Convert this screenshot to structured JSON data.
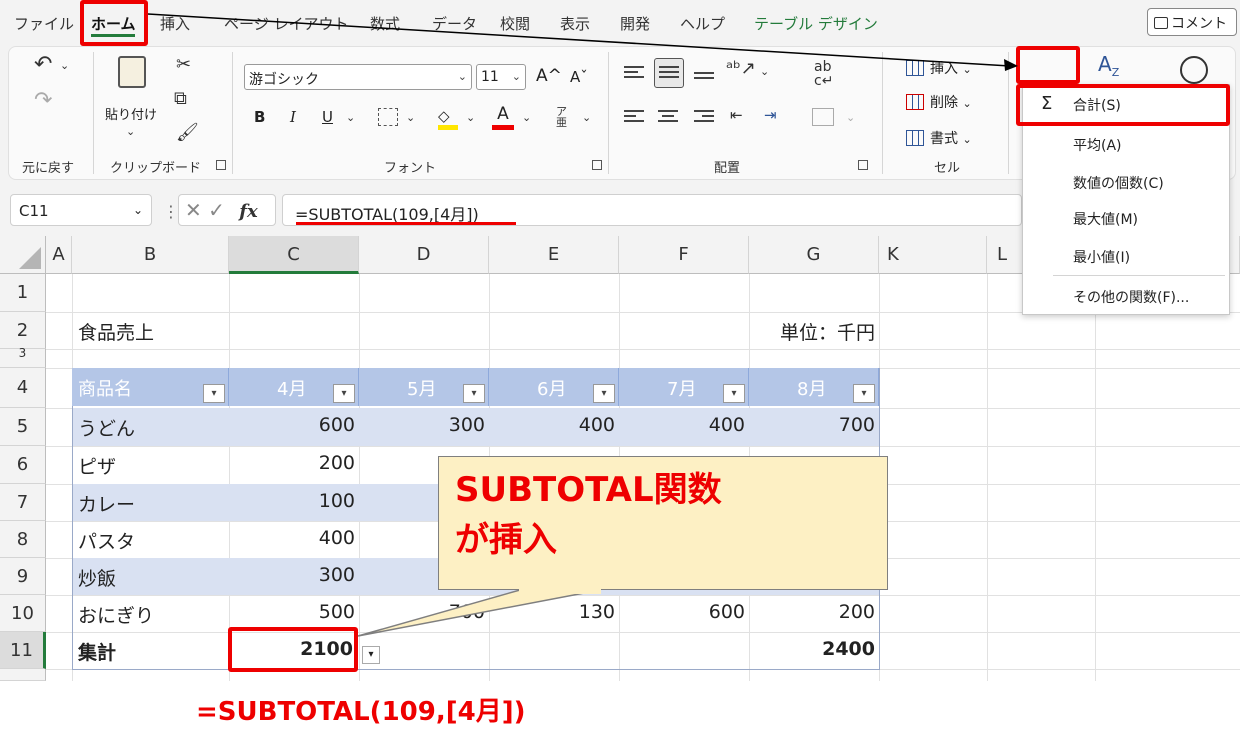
{
  "menu": {
    "tabs": [
      "ファイル",
      "ホーム",
      "挿入",
      "ページ レイアウト",
      "数式",
      "データ",
      "校閲",
      "表示",
      "開発",
      "ヘルプ",
      "テーブル デザイン"
    ],
    "comment": "コメント"
  },
  "ribbon": {
    "undo_group": "元に戻す",
    "clipboard_group": "クリップボード",
    "paste_label": "貼り付け",
    "font_group": "フォント",
    "font_name": "游ゴシック",
    "font_size": "11",
    "font_grow": "A^",
    "font_shrink": "Aˇ",
    "bold": "B",
    "italic": "I",
    "underline": "U",
    "align_group": "配置",
    "cell_group": "セル",
    "insert_label": "挿入",
    "delete_label": "削除",
    "format_label": "書式",
    "sigma": "Σ"
  },
  "autosum_menu": {
    "items": [
      "合計(S)",
      "平均(A)",
      "数値の個数(C)",
      "最大値(M)",
      "最小値(I)",
      "その他の関数(F)..."
    ]
  },
  "formula_bar": {
    "name_box": "C11",
    "cancel": "✕",
    "enter": "✓",
    "fx": "fx",
    "formula": "=SUBTOTAL(109,[4月])"
  },
  "sheet": {
    "columns": [
      "A",
      "B",
      "C",
      "D",
      "E",
      "F",
      "G",
      "K",
      "L"
    ],
    "rows": [
      "1",
      "2",
      "3",
      "4",
      "5",
      "6",
      "7",
      "8",
      "9",
      "10",
      "11"
    ],
    "title": "食品売上",
    "unit": "単位：千円",
    "headers": [
      "商品名",
      "4月",
      "5月",
      "6月",
      "7月",
      "8月"
    ],
    "items": [
      {
        "name": "うどん",
        "apr": "600",
        "may": "300",
        "jun": "400",
        "jul": "400",
        "aug": "700"
      },
      {
        "name": "ピザ",
        "apr": "200"
      },
      {
        "name": "カレー",
        "apr": "100"
      },
      {
        "name": "パスタ",
        "apr": "400"
      },
      {
        "name": "炒飯",
        "apr": "300"
      },
      {
        "name": "おにぎり",
        "apr": "500",
        "may": "700",
        "jun": "130",
        "jul": "600",
        "aug": "200"
      }
    ],
    "total_label": "集計",
    "total_apr": "2100",
    "total_aug": "2400"
  },
  "annotation": {
    "callout": "SUBTOTAL関数\nが挿入",
    "bottom_formula": "=SUBTOTAL(109,[4月])"
  },
  "colors": {
    "accent_green": "#237b3b",
    "highlight_red": "#e00000",
    "table_header": "#b4c6e7",
    "table_band": "#d9e1f2",
    "callout_fill": "#fdf0c4"
  }
}
